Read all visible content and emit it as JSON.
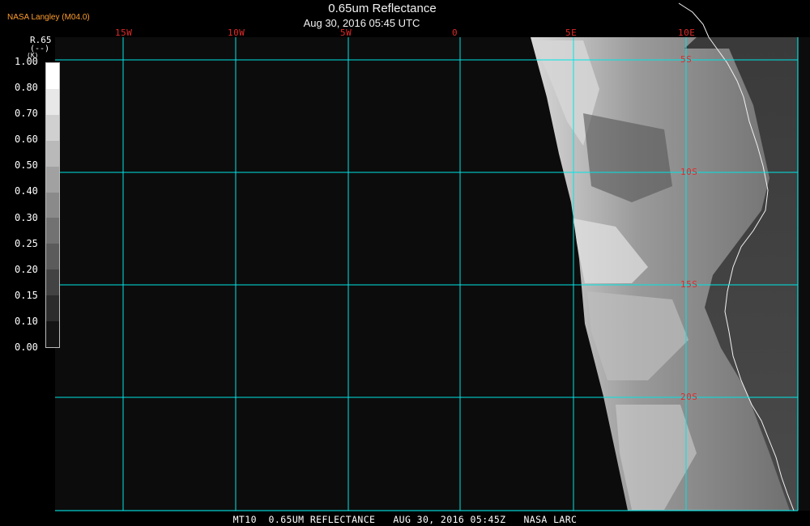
{
  "header": {
    "brand": "NASA Langley (M04.0)",
    "title": "0.65um Reflectance",
    "timestamp": "Aug 30, 2016 05:45 UTC"
  },
  "legend": {
    "title": "R.65",
    "units": "(--)",
    "unit_k": "(K)",
    "ticks": [
      "1.00",
      "0.80",
      "0.70",
      "0.60",
      "0.50",
      "0.40",
      "0.30",
      "0.25",
      "0.20",
      "0.15",
      "0.10",
      "0.00"
    ]
  },
  "map": {
    "longitude_labels": [
      "15W",
      "10W",
      "5W",
      "0",
      "5E",
      "10E"
    ],
    "latitude_labels": [
      "5S",
      "10S",
      "15S",
      "20S"
    ],
    "grid_color": "#00e5e5",
    "label_color": "#e02a2a"
  },
  "footer": {
    "caption": "MT10  0.65UM REFLECTANCE   AUG 30, 2016 05:45Z   NASA LARC"
  }
}
